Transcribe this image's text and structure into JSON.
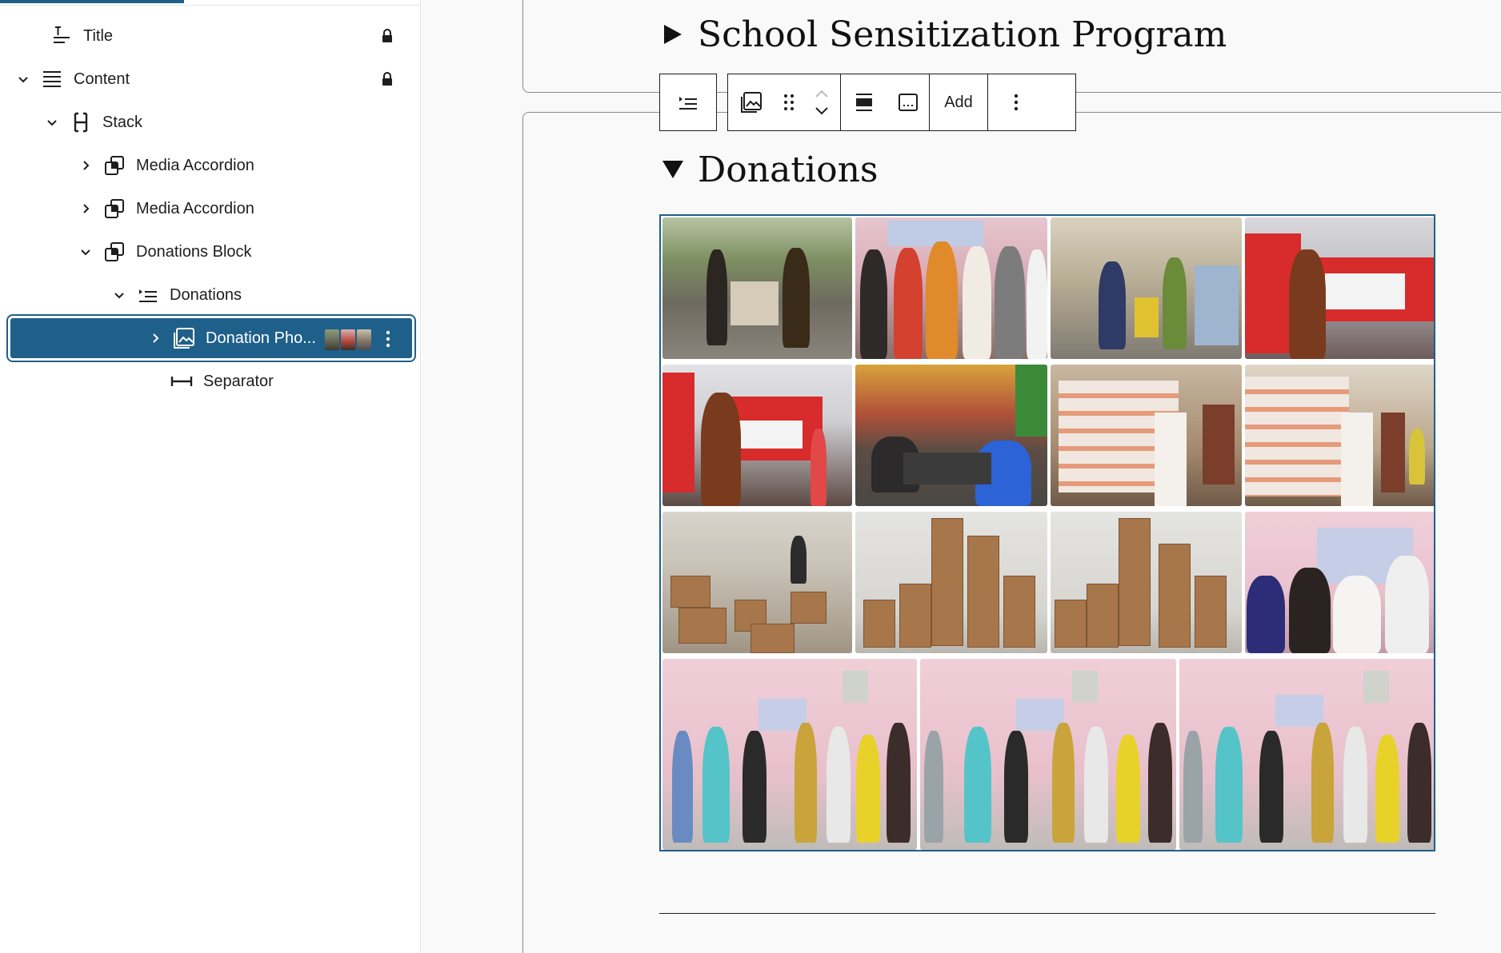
{
  "list_view": {
    "items": [
      {
        "label": "Title",
        "icon": "title-icon",
        "locked": true
      },
      {
        "label": "Content",
        "icon": "content-icon",
        "locked": true,
        "expanded": true
      },
      {
        "label": "Stack",
        "icon": "stack-icon",
        "expanded": true
      },
      {
        "label": "Media Accordion",
        "icon": "block-copy-icon",
        "expanded": false
      },
      {
        "label": "Media Accordion",
        "icon": "block-copy-icon",
        "expanded": false
      },
      {
        "label": "Donations Block",
        "icon": "block-copy-icon",
        "expanded": true
      },
      {
        "label": "Donations",
        "icon": "details-icon",
        "expanded": true
      },
      {
        "label": "Donation Pho...",
        "icon": "gallery-icon",
        "expanded": false,
        "selected": true
      },
      {
        "label": "Separator",
        "icon": "separator-icon"
      }
    ]
  },
  "editor": {
    "section1_heading": "School Sensitization Program",
    "section2_heading": "Donations",
    "toolbar": {
      "add_label": "Add"
    }
  },
  "colors": {
    "accent": "#1e6089",
    "canvas_bg": "#f9f9f9"
  }
}
